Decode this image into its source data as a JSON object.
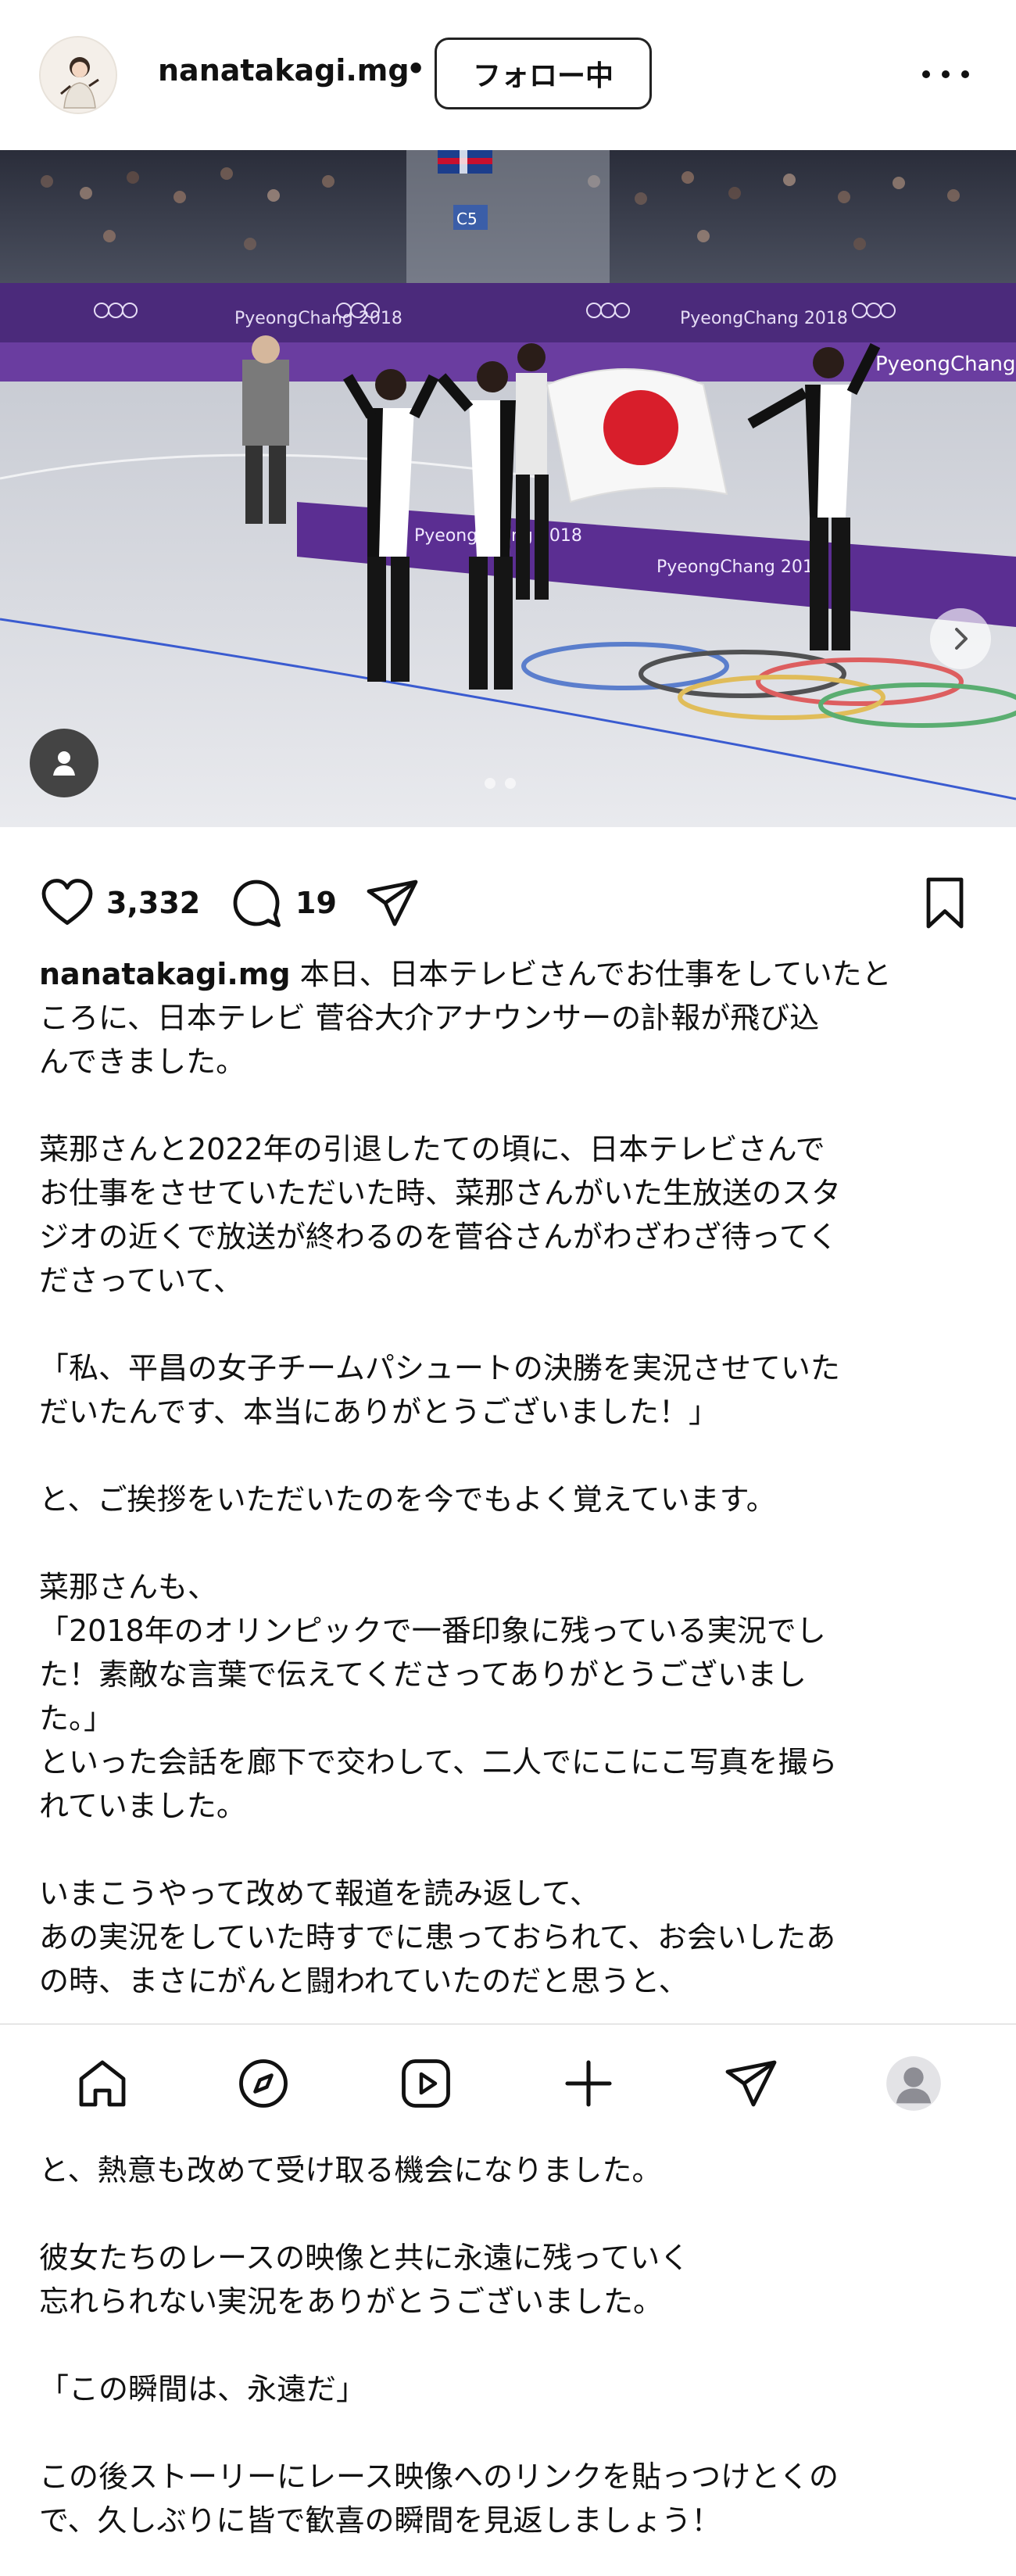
{
  "header": {
    "username": "nanatakagi.mg",
    "separator": "•",
    "follow_label": "フォロー中",
    "more_icon": "more-horizontal-icon"
  },
  "photo": {
    "banner_text": "PyeongChang 2018",
    "board_text": "PyeongChang 2018",
    "section_sign": "C5"
  },
  "actions": {
    "likes": "3,332",
    "comments": "19"
  },
  "caption": {
    "username": "nanatakagi.mg",
    "lines": [
      "本日、日本テレビさんでお仕事をしていたと",
      "ころに、日本テレビ 菅谷大介アナウンサーの訃報が飛び込",
      "んできました。",
      "",
      "菜那さんと2022年の引退したての頃に、日本テレビさんで",
      "お仕事をさせていただいた時、菜那さんがいた生放送のスタ",
      "ジオの近くで放送が終わるのを菅谷さんがわざわざ待ってく",
      "ださっていて、",
      "",
      "「私、平昌の女子チームパシュートの決勝を実況させていた",
      "だいたんです、本当にありがとうございました！」",
      "",
      "と、ご挨拶をいただいたのを今でもよく覚えています。",
      "",
      "菜那さんも、",
      "「2018年のオリンピックで一番印象に残っている実況でし",
      "た！素敵な言葉で伝えてくださってありがとうございまし",
      "た。」",
      "といった会話を廊下で交わして、二人でにこにこ写真を撮ら",
      "れていました。",
      "",
      "いまこうやって改めて報道を読み返して、",
      "あの実況をしていた時すでに患っておられて、お会いしたあ",
      "の時、まさにがんと闘われていたのだと思うと、"
    ],
    "after_lines": [
      "と、熱意も改めて受け取る機会になりました。",
      "",
      "彼女たちのレースの映像と共に永遠に残っていく",
      "忘れられない実況をありがとうございました。",
      "",
      "「この瞬間は、永遠だ」",
      "",
      "この後ストーリーにレース映像へのリンクを貼っつけとくの",
      "で、久しぶりに皆で歓喜の瞬間を見返しましょう！"
    ]
  },
  "tabbar": {
    "items": [
      "home-icon",
      "explore-icon",
      "reels-icon",
      "create-icon",
      "direct-icon",
      "profile-avatar"
    ]
  }
}
